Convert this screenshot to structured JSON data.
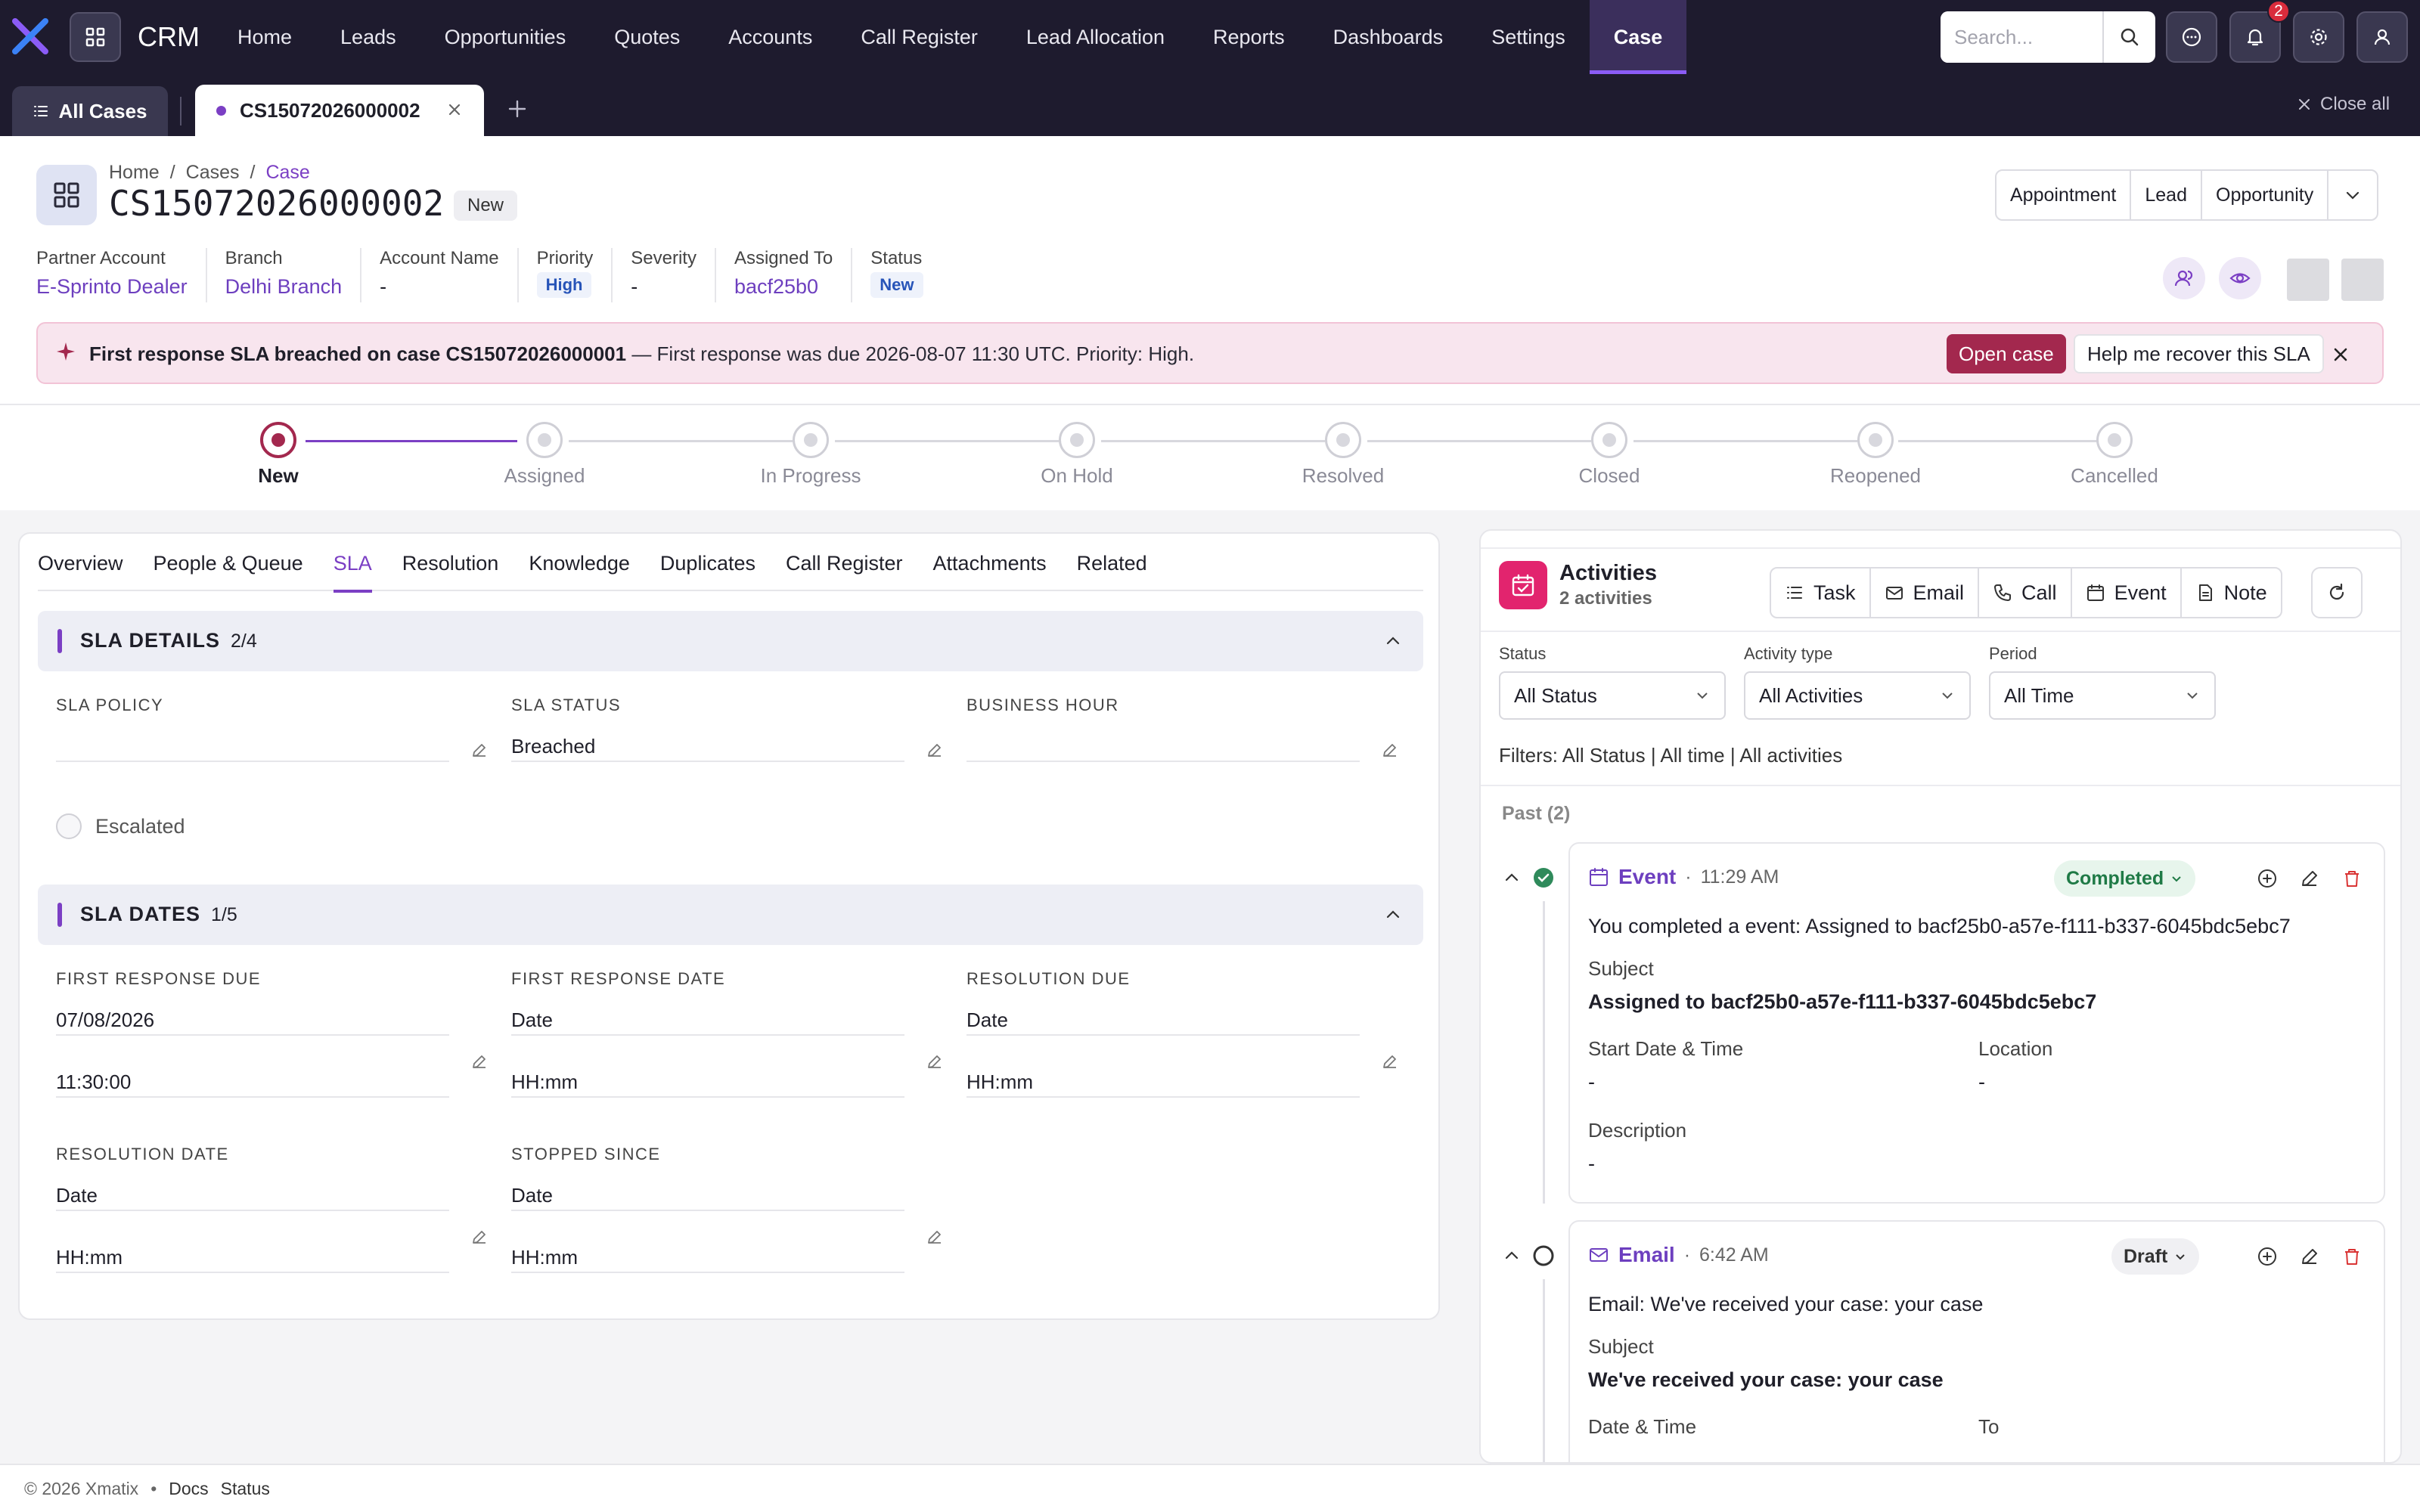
{
  "nav": {
    "brand": "CRM",
    "items": [
      "Home",
      "Leads",
      "Opportunities",
      "Quotes",
      "Accounts",
      "Call Register",
      "Lead Allocation",
      "Reports",
      "Dashboards",
      "Settings",
      "Case"
    ],
    "active_item": "Case",
    "search_placeholder": "Search...",
    "notification_count": "2",
    "accent_color": "#7b3fc4",
    "icons": [
      "app-grid-icon",
      "search-icon",
      "chat-icon",
      "bell-icon",
      "gear-icon",
      "user-icon"
    ]
  },
  "tabs": {
    "all_label": "All Cases",
    "open_tab": "CS15072026000002",
    "close_all": "Close all"
  },
  "header": {
    "breadcrumb": [
      "Home",
      "Cases",
      "Case"
    ],
    "case_number": "CS15072026000002",
    "status_pill": "New",
    "actions": [
      "Appointment",
      "Lead",
      "Opportunity"
    ]
  },
  "meta": [
    {
      "label": "Partner Account",
      "value": "E-Sprinto Dealer"
    },
    {
      "label": "Branch",
      "value": "Delhi Branch"
    },
    {
      "label": "Account Name",
      "value": "-"
    },
    {
      "label": "Priority",
      "value": "High"
    },
    {
      "label": "Severity",
      "value": "-"
    },
    {
      "label": "Assigned To",
      "value": "bacf25b0"
    },
    {
      "label": "Status",
      "value": "New"
    }
  ],
  "banner": {
    "bold": "First response SLA breached on case CS15072026000001",
    "text": " — First response was due 2026-08-07 11:30 UTC. Priority: High.",
    "open_button": "Open case",
    "help_button": "Help me recover this SLA",
    "color": "#a3284e"
  },
  "stages": [
    "New",
    "Assigned",
    "In Progress",
    "On Hold",
    "Resolved",
    "Closed",
    "Reopened",
    "Cancelled"
  ],
  "active_stage": "New",
  "subtabs": [
    "Overview",
    "People & Queue",
    "SLA",
    "Resolution",
    "Knowledge",
    "Duplicates",
    "Call Register",
    "Attachments",
    "Related"
  ],
  "active_subtab": "SLA",
  "sla_details": {
    "title": "SLA DETAILS",
    "count": "2/4",
    "fields": [
      {
        "label": "SLA POLICY",
        "value": ""
      },
      {
        "label": "SLA STATUS",
        "value": "Breached"
      },
      {
        "label": "BUSINESS HOUR",
        "value": ""
      }
    ],
    "escalated_label": "Escalated"
  },
  "sla_dates": {
    "title": "SLA DATES",
    "count": "1/5",
    "fields": [
      {
        "label": "FIRST RESPONSE DUE",
        "date": "07/08/2026",
        "time": "11:30:00"
      },
      {
        "label": "FIRST RESPONSE DATE",
        "date": "Date",
        "time": "HH:mm"
      },
      {
        "label": "RESOLUTION DUE",
        "date": "Date",
        "time": "HH:mm"
      },
      {
        "label": "RESOLUTION DATE",
        "date": "Date",
        "time": "HH:mm"
      },
      {
        "label": "STOPPED SINCE",
        "date": "Date",
        "time": "HH:mm"
      }
    ]
  },
  "activities": {
    "title": "Activities",
    "subtitle": "2 activities",
    "buttons": [
      "Task",
      "Email",
      "Call",
      "Event",
      "Note"
    ],
    "filters": [
      {
        "label": "Status",
        "value": "All Status"
      },
      {
        "label": "Activity type",
        "value": "All Activities"
      },
      {
        "label": "Period",
        "value": "All Time"
      }
    ],
    "filter_summary": "Filters: All Status | All time | All activities",
    "past_label": "Past (2)",
    "items": [
      {
        "type": "Event",
        "time": "11:29 AM",
        "status": "Completed",
        "summary": "You completed a event: Assigned to bacf25b0-a57e-f111-b337-6045bdc5ebc7",
        "subject_label": "Subject",
        "subject": "Assigned to bacf25b0-a57e-f111-b337-6045bdc5ebc7",
        "start_label": "Start Date & Time",
        "start": "-",
        "location_label": "Location",
        "location": "-",
        "description_label": "Description",
        "description": "-"
      },
      {
        "type": "Email",
        "time": "6:42 AM",
        "status": "Draft",
        "summary": "Email: We've received your case: your case",
        "subject_label": "Subject",
        "subject": "We've received your case: your case",
        "date_label": "Date & Time",
        "to_label": "To"
      }
    ]
  },
  "footer": {
    "copyright": "© 2026 Xmatix",
    "links": [
      "Docs",
      "Status"
    ]
  }
}
